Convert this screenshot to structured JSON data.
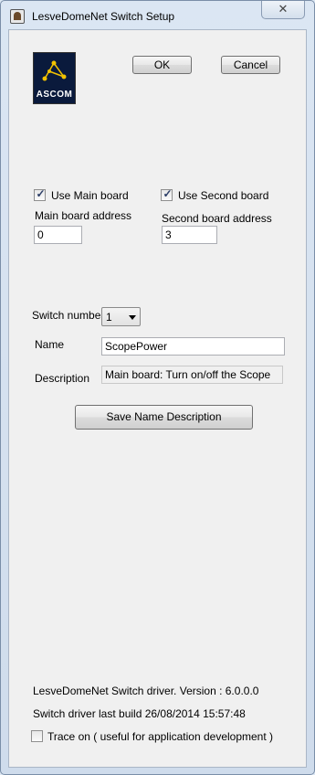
{
  "window": {
    "title": "LesveDomeNet Switch Setup",
    "close_label": "✕"
  },
  "logo": {
    "text": "ASCOM"
  },
  "buttons": {
    "ok": "OK",
    "cancel": "Cancel",
    "save": "Save Name  Description"
  },
  "main_board": {
    "checkbox_label": "Use Main board",
    "checked": true,
    "address_label": "Main board address",
    "address_value": "0"
  },
  "second_board": {
    "checkbox_label": "Use Second board",
    "checked": true,
    "address_label": "Second board address",
    "address_value": "3"
  },
  "switch": {
    "number_label": "Switch number",
    "number_value": "1",
    "name_label": "Name",
    "name_value": "ScopePower",
    "description_label": "Description",
    "description_value": "Main board: Turn on/off the Scope"
  },
  "footer": {
    "version": "LesveDomeNet Switch driver. Version : 6.0.0.0",
    "build": "Switch driver last build 26/08/2014 15:57:48",
    "trace_label": "Trace on ( useful for application development )",
    "trace_checked": false
  },
  "colors": {
    "window_frame": "#dbe6f3",
    "client_bg": "#f0f0f0",
    "logo_bg": "#0a1a3c",
    "logo_star": "#f2c200"
  }
}
